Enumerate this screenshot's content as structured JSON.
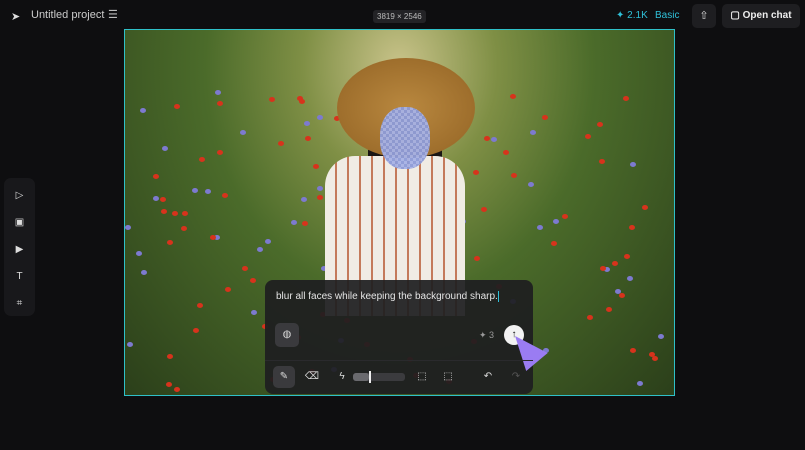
{
  "header": {
    "logo_icon": "cursor-logo-icon",
    "project_title": "Untitled project",
    "menu_icon": "menu-icon",
    "dimensions": "3819 × 2546",
    "credits": "2.1K",
    "credits_icon": "sparkle-icon",
    "plan": "Basic",
    "share_icon": "share-icon",
    "open_chat": "Open chat"
  },
  "sidebar": {
    "tools": [
      "select-tool",
      "image-tool",
      "video-tool",
      "text-tool",
      "frame-tool"
    ]
  },
  "prompt_panel": {
    "text": "blur all faces while keeping the background sharp.",
    "count": "3",
    "send_icon": "arrow-up-icon"
  },
  "toolbar": {
    "tools": [
      "brush",
      "eraser",
      "lasso-brush",
      "rect-select",
      "smart-select",
      "undo",
      "redo"
    ],
    "brush_size_percent": 30
  },
  "colors": {
    "accent": "#2fc0d8",
    "cursor": "#9a7cf2"
  }
}
